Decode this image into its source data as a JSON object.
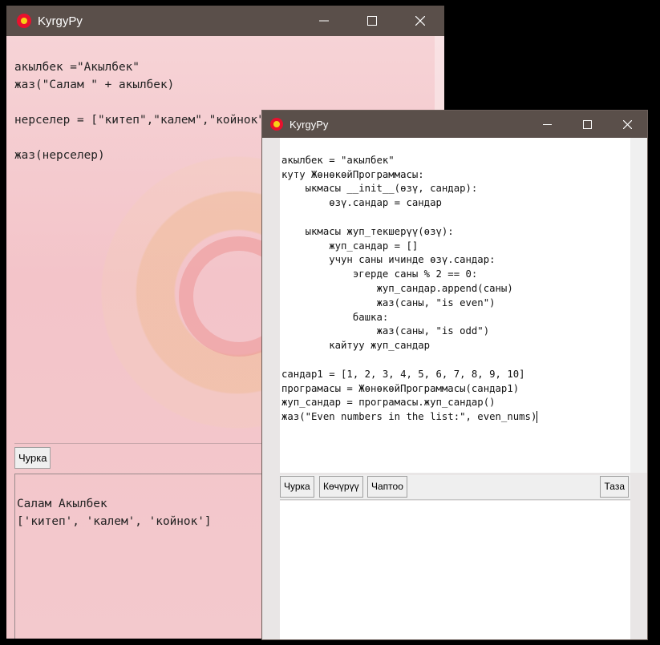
{
  "window1": {
    "title": "KyrgyPy",
    "editor_lines": [
      "акылбек =\"Акылбек\"",
      "жаз(\"Салам \" + акылбек)",
      "",
      "нерселер = [\"китеп\",\"калем\",\"койнок\"]",
      "",
      "жаз(нерселер)"
    ],
    "run_button": "Чурка",
    "output_lines": [
      "Салам Акылбек",
      "['китеп', 'калем', 'койнок']"
    ]
  },
  "window2": {
    "title": "KyrgyPy",
    "editor_lines": [
      "акылбек = \"акылбек\"",
      "куту ЖөнөкөйПрограммасы:",
      "    ыкмасы __init__(өзү, сандар):",
      "        өзү.сандар = сандар",
      "",
      "    ыкмасы жуп_текшерүү(өзү):",
      "        жуп_сандар = []",
      "        учун саны ичинде өзү.сандар:",
      "            эгерде саны % 2 == 0:",
      "                жуп_сандар.append(саны)",
      "                жаз(саны, \"is even\")",
      "            башка:",
      "                жаз(саны, \"is odd\")",
      "        кайтуу жуп_сандар",
      "",
      "сандар1 = [1, 2, 3, 4, 5, 6, 7, 8, 9, 10]",
      "програмасы = ЖөнөкөйПрограммасы(сандар1)",
      "жуп_сандар = програмасы.жуп_сандар()",
      "жаз(\"Even numbers in the list:\", even_nums)"
    ],
    "buttons": {
      "run": "Чурка",
      "copy": "Көчүрүү",
      "print": "Чаптоо",
      "clear": "Таза"
    }
  },
  "colors": {
    "titlebar": "#5a4f4a",
    "flag_red": "#e8112d",
    "flag_yellow": "#f7d117"
  },
  "icons": [
    "kyrgyz-flag-icon",
    "minimize-icon",
    "maximize-icon",
    "close-icon"
  ]
}
